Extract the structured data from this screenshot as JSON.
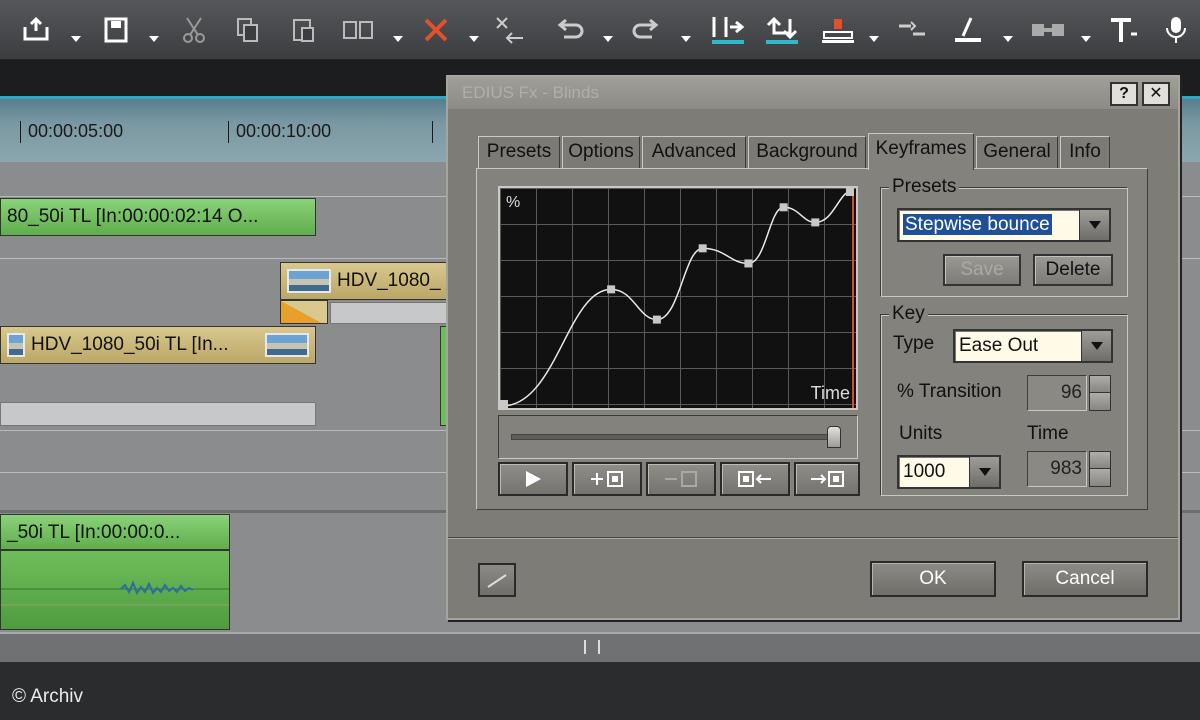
{
  "toolbar": {
    "icons": [
      "export-icon",
      "save-icon",
      "cut-icon",
      "copy-icon",
      "paste-icon",
      "replace-icon",
      "delete-icon",
      "ripple-delete-icon",
      "undo-icon",
      "redo-icon",
      "insert-icon",
      "overwrite-icon",
      "mark-in-icon",
      "split-icon",
      "trim-icon",
      "link-icon",
      "title-icon",
      "mic-icon"
    ]
  },
  "timeline": {
    "ruler": {
      "marks": [
        "00:00:05:00",
        "00:00:10:00"
      ]
    },
    "clips": {
      "clip1": "80_50i  TL [In:00:00:02:14 O...",
      "clip2": "HDV_1080_",
      "clip3": "HDV_1080_50i  TL [In...",
      "clip4": "_50i  TL [In:00:00:0..."
    }
  },
  "dialog": {
    "title": "EDIUS Fx - Blinds",
    "help_label": "?",
    "close_label": "✕",
    "tabs": [
      {
        "label": "Presets",
        "active": false
      },
      {
        "label": "Options",
        "active": false
      },
      {
        "label": "Advanced",
        "active": false
      },
      {
        "label": "Background",
        "active": false
      },
      {
        "label": "Keyframes",
        "active": true
      },
      {
        "label": "General",
        "active": false
      },
      {
        "label": "Info",
        "active": false
      }
    ],
    "graph": {
      "y_label": "%",
      "x_label": "Time",
      "keyframes": [
        {
          "time": 0.0,
          "percent": 0.0
        },
        {
          "time": 0.31,
          "percent": 0.54
        },
        {
          "time": 0.44,
          "percent": 0.4
        },
        {
          "time": 0.57,
          "percent": 0.73
        },
        {
          "time": 0.7,
          "percent": 0.66
        },
        {
          "time": 0.8,
          "percent": 0.92
        },
        {
          "time": 0.89,
          "percent": 0.85
        },
        {
          "time": 1.0,
          "percent": 1.0
        }
      ],
      "playhead": 1.0,
      "slider_position": 0.98
    },
    "playback_buttons": [
      {
        "name": "play-button",
        "label": "▶",
        "enabled": true
      },
      {
        "name": "add-keyframe-button",
        "label": "+□",
        "enabled": true
      },
      {
        "name": "remove-keyframe-button",
        "label": "−□",
        "enabled": false
      },
      {
        "name": "prev-keyframe-button",
        "label": "□←",
        "enabled": true
      },
      {
        "name": "next-keyframe-button",
        "label": "→□",
        "enabled": true
      }
    ],
    "presets": {
      "group_label": "Presets",
      "selected": "Stepwise bounce",
      "save_label": "Save",
      "delete_label": "Delete"
    },
    "key": {
      "group_label": "Key",
      "type_label": "Type",
      "type_value": "Ease Out",
      "transition_label": "% Transition",
      "transition_value": "96",
      "units_label": "Units",
      "units_value": "1000",
      "time_label": "Time",
      "time_value": "983"
    },
    "ok_label": "OK",
    "cancel_label": "Cancel"
  },
  "footer": {
    "copyright": "© Archiv"
  },
  "colors": {
    "graph_curve": "#e9e9e9",
    "playhead": "#d24a3a",
    "selection": "#1f4f94"
  }
}
